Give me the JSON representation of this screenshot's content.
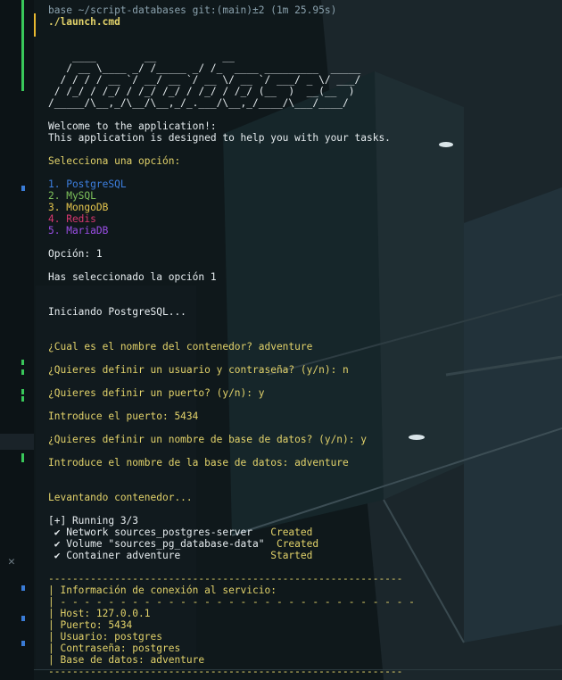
{
  "prompt": {
    "status": "base ~/script-databases git:(main)±2 (1m 25.95s)",
    "command": "./launch.cmd"
  },
  "banner": [
    "    ____        __           __",
    "   / __ \\____ _/ /_____ _/ /_  ____ _________  _____",
    "  / / / / __ `/ __/ __ `/ __ \\/ __ `/ ___/ _ \\/ ___/",
    " / /_/ / /_/ / /_/ /_/ / /_/ / /_/ (__  )  __(__  )",
    "/_____/\\__,_/\\__/\\__,_/_.___/\\__,_/____/\\___/____/"
  ],
  "welcome": [
    "Welcome to the application!:",
    "This application is designed to help you with your tasks."
  ],
  "select_prompt": "Selecciona una opción:",
  "options": [
    {
      "label": "1. PostgreSQL",
      "color": "#3d7fe0"
    },
    {
      "label": "2. MySQL",
      "color": "#7ec25b"
    },
    {
      "label": "3. MongoDB",
      "color": "#e6c64d"
    },
    {
      "label": "4. Redis",
      "color": "#d8386f"
    },
    {
      "label": "5. MariaDB",
      "color": "#9b4ee6"
    }
  ],
  "selected": "Opción: 1",
  "selected_msg": "Has seleccionado la opción 1",
  "starting": "Iniciando PostgreSQL...",
  "questions": {
    "container_name": "¿Cual es el nombre del contenedor? adventure",
    "user_pass": "¿Quieres definir un usuario y contraseña? (y/n): n",
    "port_q": "¿Quieres definir un puerto? (y/n): y",
    "port_in": "Introduce el puerto: 5434",
    "db_q": "¿Quieres definir un nombre de base de datos? (y/n): y",
    "db_in": "Introduce el nombre de la base de datos: adventure"
  },
  "raising": "Levantando contenedor...",
  "running": "[+] Running 3/3",
  "steps": [
    {
      "text": " ✔ Network sources_postgres-server   ",
      "status": "Created"
    },
    {
      "text": " ✔ Volume \"sources_pg_database-data\"  ",
      "status": "Created"
    },
    {
      "text": " ✔ Container adventure               ",
      "status": "Started"
    }
  ],
  "info": {
    "rule": "-----------------------------------------------------------",
    "title": "| Información de conexión al servicio:",
    "dash": "| - - - - - - - - - - - - - - - - - - - - - - - - - - - - - -",
    "host": "| Host: 127.0.0.1",
    "port": "| Puerto: 5434",
    "user": "| Usuario: postgres",
    "pass": "| Contraseña: postgres",
    "db": "| Base de datos: adventure"
  },
  "colors": {
    "accent_green": "#39c75a",
    "prompt_yellow": "#e2d26a",
    "text_white": "#e6ecef"
  },
  "icons": {
    "close": "close-icon"
  }
}
